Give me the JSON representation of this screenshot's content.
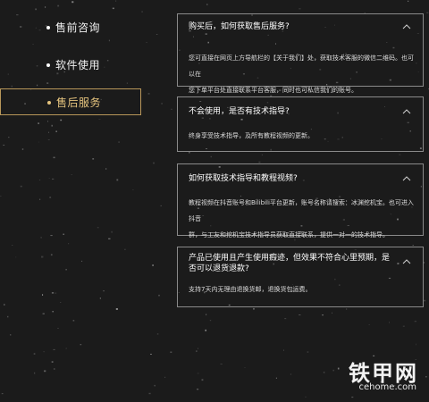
{
  "nav": {
    "items": [
      {
        "label": "售前咨询",
        "active": false
      },
      {
        "label": "软件使用",
        "active": false
      },
      {
        "label": "售后服务",
        "active": true
      }
    ]
  },
  "faq": [
    {
      "question": "购买后，如何获取售后服务?",
      "answer_lines": [
        "您可直接在网页上方导航栏的【关于我们】处，获取技术客服的微信二维码。也可以在",
        "您下单平台处直接联系平台客服，同时也可私信我们的账号。"
      ]
    },
    {
      "question": "不会使用，是否有技术指导?",
      "answer_lines": [
        "终身享受技术指导，及所有教程视频的更新。"
      ]
    },
    {
      "question": "如何获取技术指导和教程视频?",
      "answer_lines": [
        "教程视频在抖音账号和Bilibili平台更新，账号名称请搜索：冰渊挖机宝。也可进入抖音",
        "群，与工友和挖机宝技术指导员获取直接联系，提供一对一的技术指导。"
      ]
    },
    {
      "question": "产品已使用且产生使用瘕迹，但效果不符合心里预期，是否可以退货退款?",
      "answer_lines": [
        "支持7天内无理由退换货邮，退换货包运费。"
      ]
    }
  ],
  "watermark": {
    "brand": "铁甲网",
    "domain": "cehome.com"
  },
  "colors": {
    "background": "#1b1b1b",
    "active_accent": "#e6c47e",
    "active_border": "#b8975a",
    "card_border": "#8a8a8a"
  }
}
